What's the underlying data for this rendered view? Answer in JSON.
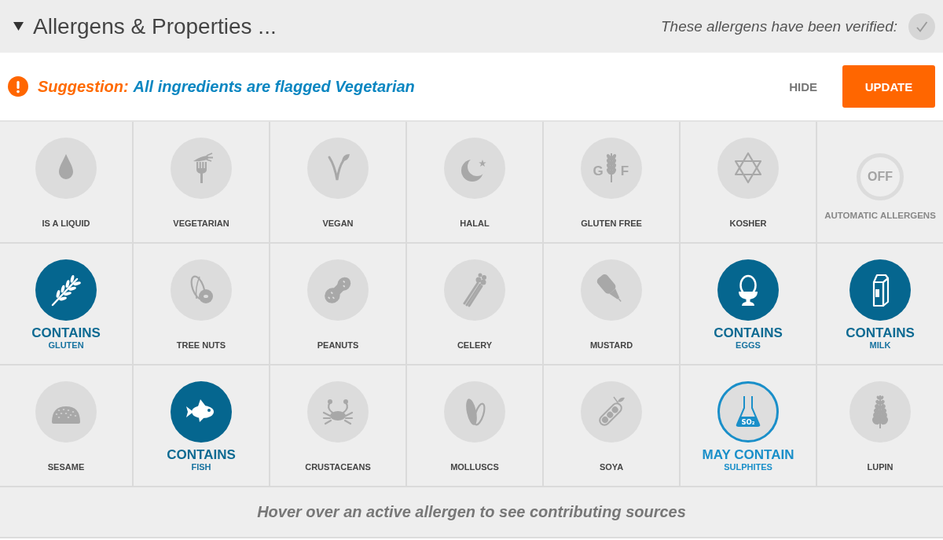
{
  "header": {
    "title": "Allergens & Properties ...",
    "expanded": true,
    "verified_label": "These allergens have been verified:",
    "verified": false
  },
  "suggestion": {
    "label": "Suggestion:",
    "message": "All ingredients are flagged Vegetarian",
    "buttons": [
      {
        "label": "HIDE",
        "kind": "text"
      },
      {
        "label": "UPDATE",
        "kind": "primary"
      }
    ]
  },
  "tiles": [
    {
      "kind": "property",
      "label": "IS A LIQUID",
      "on": false
    },
    {
      "kind": "property",
      "label": "VEGETARIAN",
      "on": false
    },
    {
      "kind": "property",
      "label": "VEGAN",
      "on": false
    },
    {
      "kind": "property",
      "label": "HALAL",
      "on": false
    },
    {
      "kind": "property",
      "label": "GLUTEN FREE",
      "on": false,
      "icon_text": [
        "G",
        "F"
      ]
    },
    {
      "kind": "property",
      "label": "KOSHER",
      "on": false
    },
    {
      "kind": "toggle",
      "label": "AUTOMATIC ALLERGENS",
      "value": "OFF",
      "on": false
    },
    {
      "kind": "allergen",
      "label": "GLUTEN",
      "contains": true,
      "may_contain": false,
      "status_label": "CONTAINS"
    },
    {
      "kind": "allergen",
      "label": "TREE NUTS",
      "contains": false,
      "may_contain": false
    },
    {
      "kind": "allergen",
      "label": "PEANUTS",
      "contains": false,
      "may_contain": false
    },
    {
      "kind": "allergen",
      "label": "CELERY",
      "contains": false,
      "may_contain": false
    },
    {
      "kind": "allergen",
      "label": "MUSTARD",
      "contains": false,
      "may_contain": false
    },
    {
      "kind": "allergen",
      "label": "EGGS",
      "contains": true,
      "may_contain": false,
      "status_label": "CONTAINS"
    },
    {
      "kind": "allergen",
      "label": "MILK",
      "contains": true,
      "may_contain": false,
      "status_label": "CONTAINS"
    },
    {
      "kind": "allergen",
      "label": "SESAME",
      "contains": false,
      "may_contain": false
    },
    {
      "kind": "allergen",
      "label": "FISH",
      "contains": true,
      "may_contain": false,
      "status_label": "CONTAINS"
    },
    {
      "kind": "allergen",
      "label": "CRUSTACEANS",
      "contains": false,
      "may_contain": false
    },
    {
      "kind": "allergen",
      "label": "MOLLUSCS",
      "contains": false,
      "may_contain": false
    },
    {
      "kind": "allergen",
      "label": "SOYA",
      "contains": false,
      "may_contain": false
    },
    {
      "kind": "allergen",
      "label": "SULPHITES",
      "contains": false,
      "may_contain": true,
      "status_label": "MAY CONTAIN",
      "icon_text": [
        "SO₂"
      ]
    },
    {
      "kind": "allergen",
      "label": "LUPIN",
      "contains": false,
      "may_contain": false
    }
  ],
  "hint": "Hover over an active allergen to see contributing sources"
}
